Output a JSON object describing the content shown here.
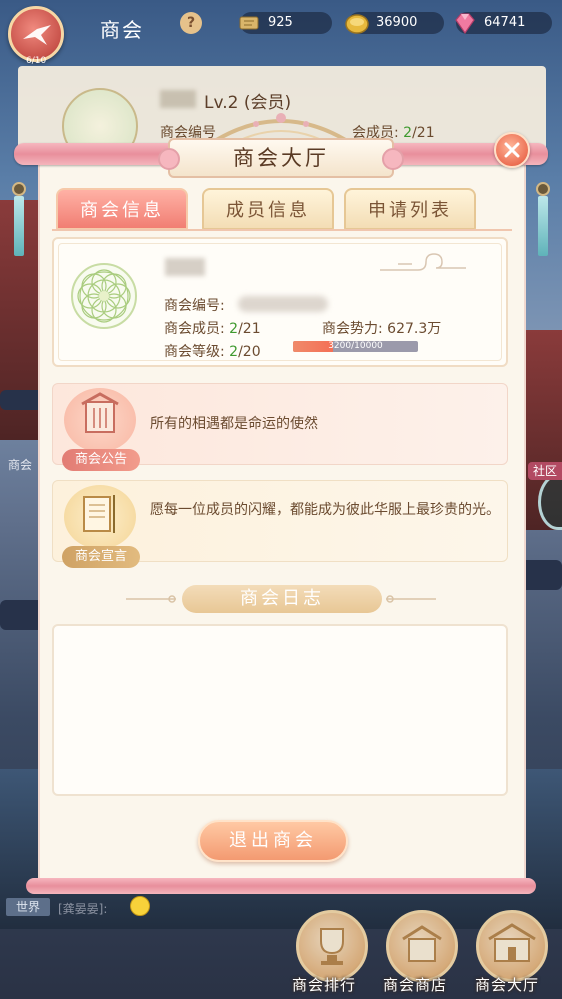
{
  "topbar": {
    "title": "商会",
    "back_counter": "6/10",
    "help": "?",
    "currencies": [
      {
        "icon": "scroll-icon",
        "value": "925"
      },
      {
        "icon": "gold-coin-icon",
        "value": "36900"
      },
      {
        "icon": "diamond-icon",
        "value": "64741"
      }
    ]
  },
  "background_card": {
    "level": "Lv.2 (会员)",
    "id_label": "商会编号",
    "members_label": "会成员:",
    "members_current": "2",
    "members_rest": "/21"
  },
  "dialog": {
    "title": "商会大厅",
    "tabs": [
      {
        "label": "商会信息",
        "active": true
      },
      {
        "label": "成员信息",
        "active": false
      },
      {
        "label": "申请列表",
        "active": false
      }
    ],
    "info": {
      "id_label": "商会编号:",
      "members_label": "商会成员:",
      "members_current": "2",
      "members_max": "/21",
      "power_label": "商会势力:",
      "power_value": "627.3万",
      "level_label": "商会等级:",
      "level_current": "2",
      "level_max": "/20",
      "xp_text": "3200/10000",
      "xp_fraction": 0.32
    },
    "notice": {
      "badge": "商会公告",
      "text": "所有的相遇都是命运的使然"
    },
    "declaration": {
      "badge": "商会宣言",
      "text": "愿每一位成员的闪耀，都能成为彼此华服上最珍贵的光。"
    },
    "log_title": "商会日志",
    "exit_label": "退出商会"
  },
  "side": {
    "left_label": "商会",
    "right_label": "社区"
  },
  "chat": {
    "channel": "世界",
    "speaker": "[龚晏晏]:"
  },
  "bottom_nav": [
    {
      "label": "商会排行"
    },
    {
      "label": "商会商店"
    },
    {
      "label": "商会大厅"
    }
  ],
  "colors": {
    "accent_pink": "#f17e73",
    "progress_green": "#3f9a2f",
    "text_brown": "#6b4b30"
  }
}
